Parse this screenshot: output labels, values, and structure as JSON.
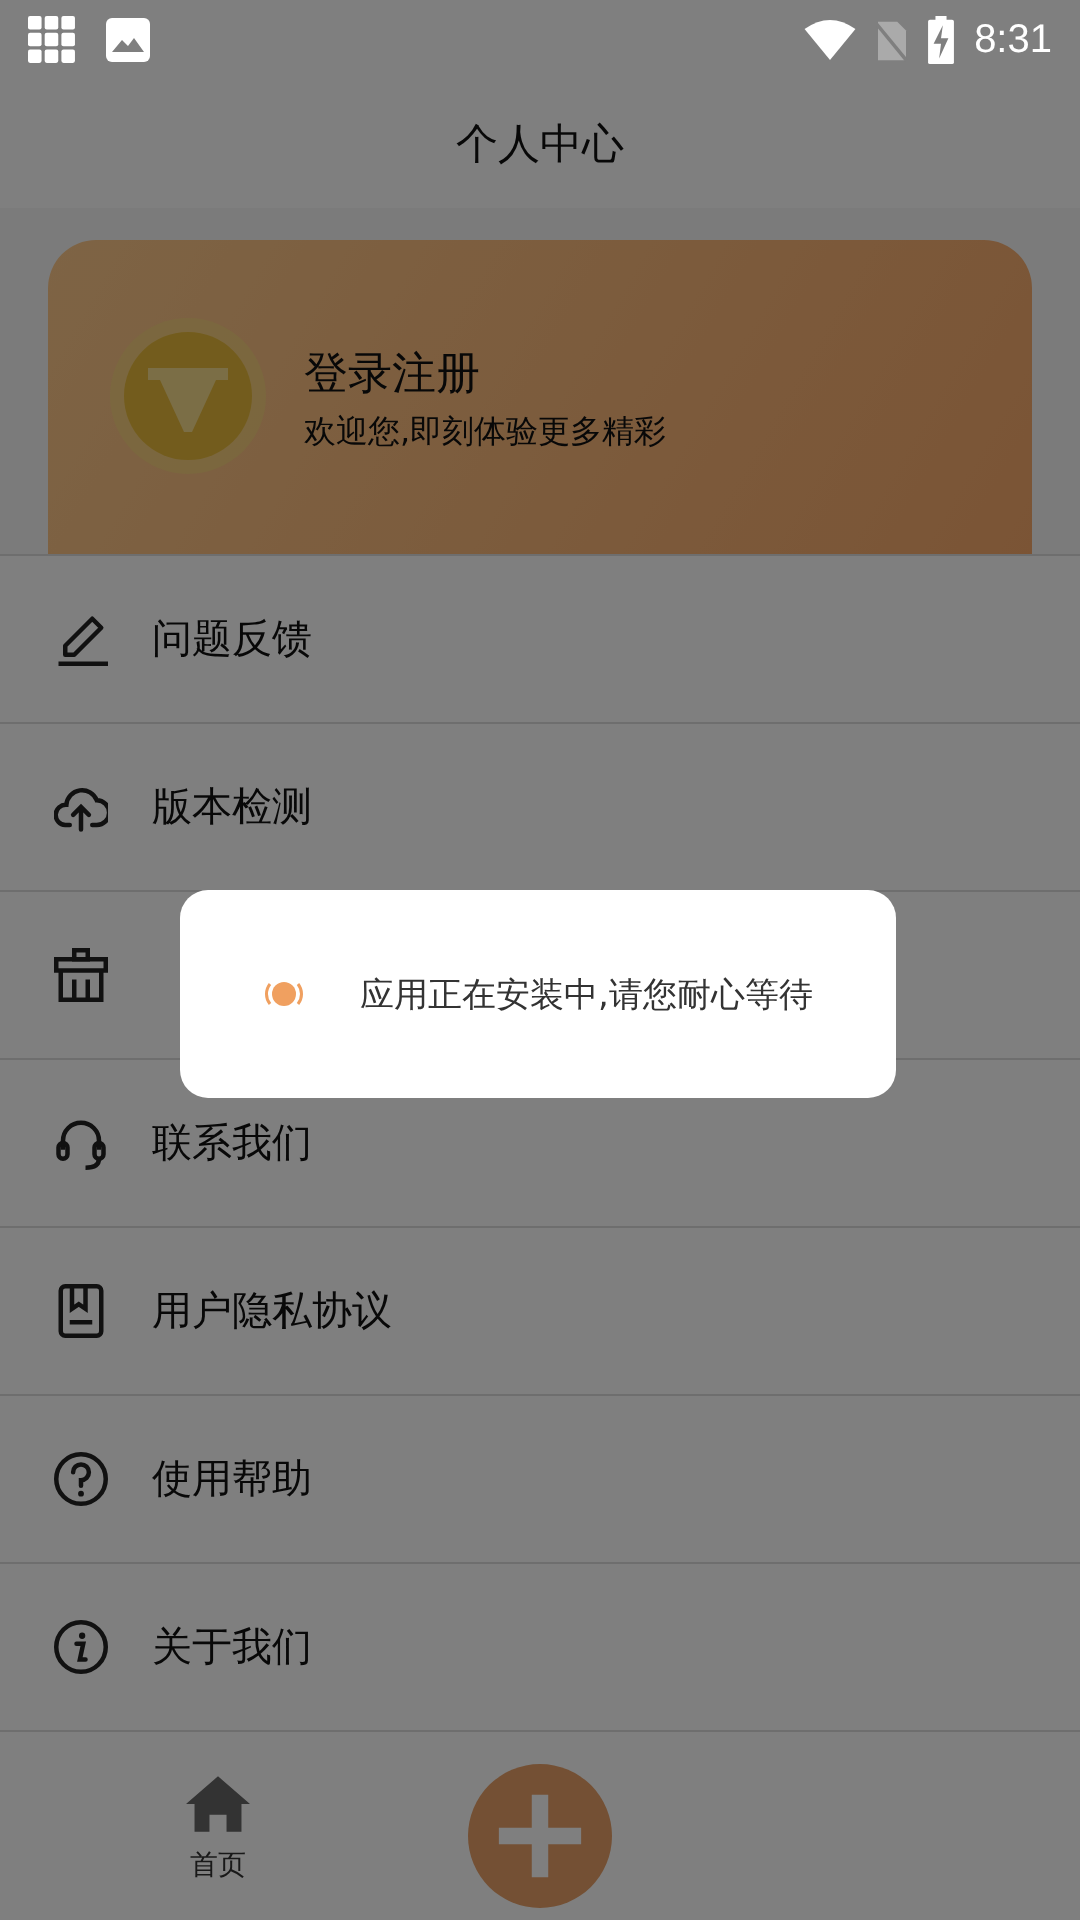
{
  "status_bar": {
    "time": "8:31"
  },
  "header": {
    "title": "个人中心"
  },
  "profile": {
    "title": "登录注册",
    "subtitle": "欢迎您,即刻体验更多精彩"
  },
  "menu": [
    {
      "kind": "pencil",
      "label": "问题反馈"
    },
    {
      "kind": "upload",
      "label": "版本检测"
    },
    {
      "kind": "basket"
    },
    {
      "kind": "headset",
      "label": "联系我们"
    },
    {
      "kind": "document",
      "label": "用户隐私协议"
    },
    {
      "kind": "help",
      "label": "使用帮助"
    },
    {
      "kind": "info",
      "label": "关于我们"
    }
  ],
  "bottom_nav": {
    "home_label": "首页"
  },
  "dialog": {
    "message": "应用正在安装中,请您耐心等待"
  }
}
